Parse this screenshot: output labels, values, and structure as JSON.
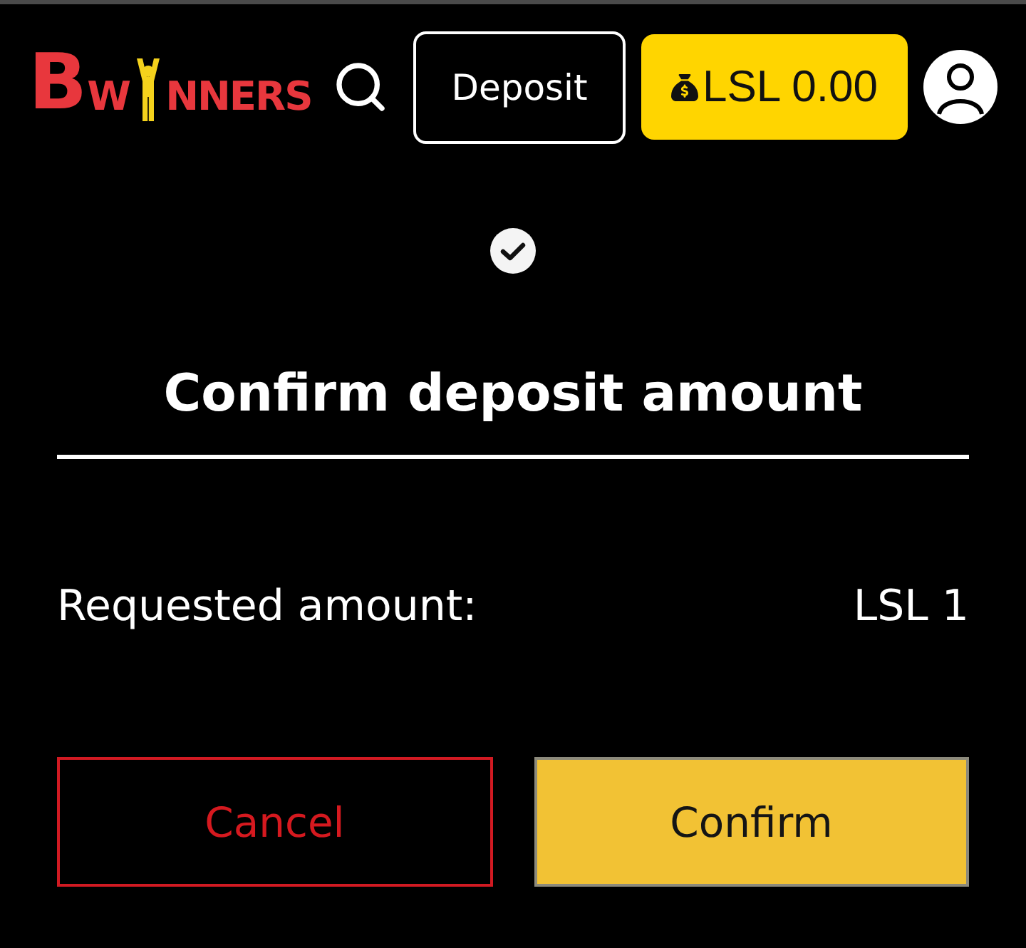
{
  "header": {
    "logo": {
      "initial": "B",
      "lead": "W",
      "tail": "NNERS"
    },
    "deposit_button": "Deposit",
    "balance": "LSL 0.00"
  },
  "dialog": {
    "title": "Confirm deposit amount",
    "rows": [
      {
        "label": "Requested amount:",
        "value": "LSL 1"
      }
    ],
    "buttons": [
      {
        "label": "Cancel",
        "kind": "secondary"
      },
      {
        "label": "Confirm",
        "kind": "primary"
      }
    ]
  }
}
